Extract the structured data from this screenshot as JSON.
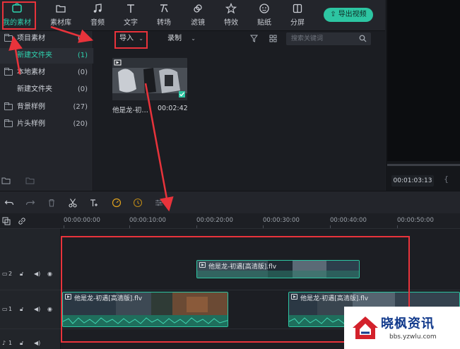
{
  "toolbar": {
    "tools": [
      {
        "label": "我的素材",
        "icon": "media-icon",
        "active": true
      },
      {
        "label": "素材库",
        "icon": "library-icon"
      },
      {
        "label": "音频",
        "icon": "music-note-icon"
      },
      {
        "label": "文字",
        "icon": "text-icon"
      },
      {
        "label": "转场",
        "icon": "transition-icon"
      },
      {
        "label": "滤镜",
        "icon": "filter-icon"
      },
      {
        "label": "特效",
        "icon": "effects-icon"
      },
      {
        "label": "贴纸",
        "icon": "sticker-icon"
      },
      {
        "label": "分屏",
        "icon": "split-screen-icon"
      }
    ],
    "export_label": "导出视频"
  },
  "sidebar": {
    "items": [
      {
        "label": "项目素材",
        "count": "(1)"
      },
      {
        "label": "新建文件夹",
        "count": "(1)"
      },
      {
        "label": "本地素材",
        "count": "(0)"
      },
      {
        "label": "新建文件夹",
        "count": "(0)"
      },
      {
        "label": "背景样例",
        "count": "(27)"
      },
      {
        "label": "片头样例",
        "count": "(20)"
      }
    ]
  },
  "media": {
    "import_label": "导入",
    "record_label": "录制",
    "search_placeholder": "搜索关键词",
    "clip_name": "他是龙-初…",
    "clip_duration": "00:02:42"
  },
  "preview": {
    "timecode": "00:01:03:13",
    "brace": "{"
  },
  "ruler": {
    "labels": [
      "00:00:00:00",
      "00:00:10:00",
      "00:00:20:00",
      "00:00:30:00",
      "00:00:40:00",
      "00:00:50:00"
    ]
  },
  "tracks": {
    "v2_clip": "他是龙-初遇[高清版].flv",
    "v1_clip_a": "他是龙-初遇[高清版].flv",
    "v1_clip_b": "他是龙-初遇[高清版].flv",
    "v2_num": "2",
    "v1_num": "1",
    "a1_num": "1"
  },
  "watermark": {
    "title": "晓枫资讯",
    "sub": "bbs.yzwlu.com"
  },
  "colors": {
    "accent": "#2dc5a2",
    "annotation_red": "#e8333b"
  }
}
